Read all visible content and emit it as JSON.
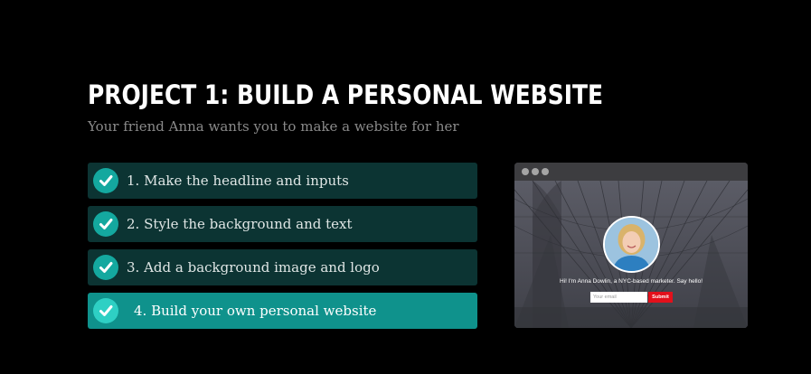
{
  "header": {
    "title": "PROJECT 1: BUILD A PERSONAL WEBSITE",
    "subtitle": "Your friend Anna wants you to make a website for her"
  },
  "steps": [
    {
      "label": "1. Make the headline and inputs",
      "completed": true,
      "active": false
    },
    {
      "label": "2. Style the background and text",
      "completed": true,
      "active": false
    },
    {
      "label": "3. Add a background image and logo",
      "completed": true,
      "active": false
    },
    {
      "label": "4. Build your own personal website",
      "completed": true,
      "active": true
    }
  ],
  "preview": {
    "tagline": "Hi! I'm Anna Dowlin, a NYC-based marketer. Say hello!",
    "email_placeholder": "Your email",
    "submit_label": "Submit"
  },
  "colors": {
    "background": "#000000",
    "step_bg": "#0c3433",
    "step_active_bg": "#0f928c",
    "check_bg": "#14a89f",
    "submit_red": "#e3101b"
  },
  "icons": {
    "step_check": "checkmark-circle-icon",
    "browser_dots": "window-dot-icon",
    "avatar": "avatar-photo"
  }
}
